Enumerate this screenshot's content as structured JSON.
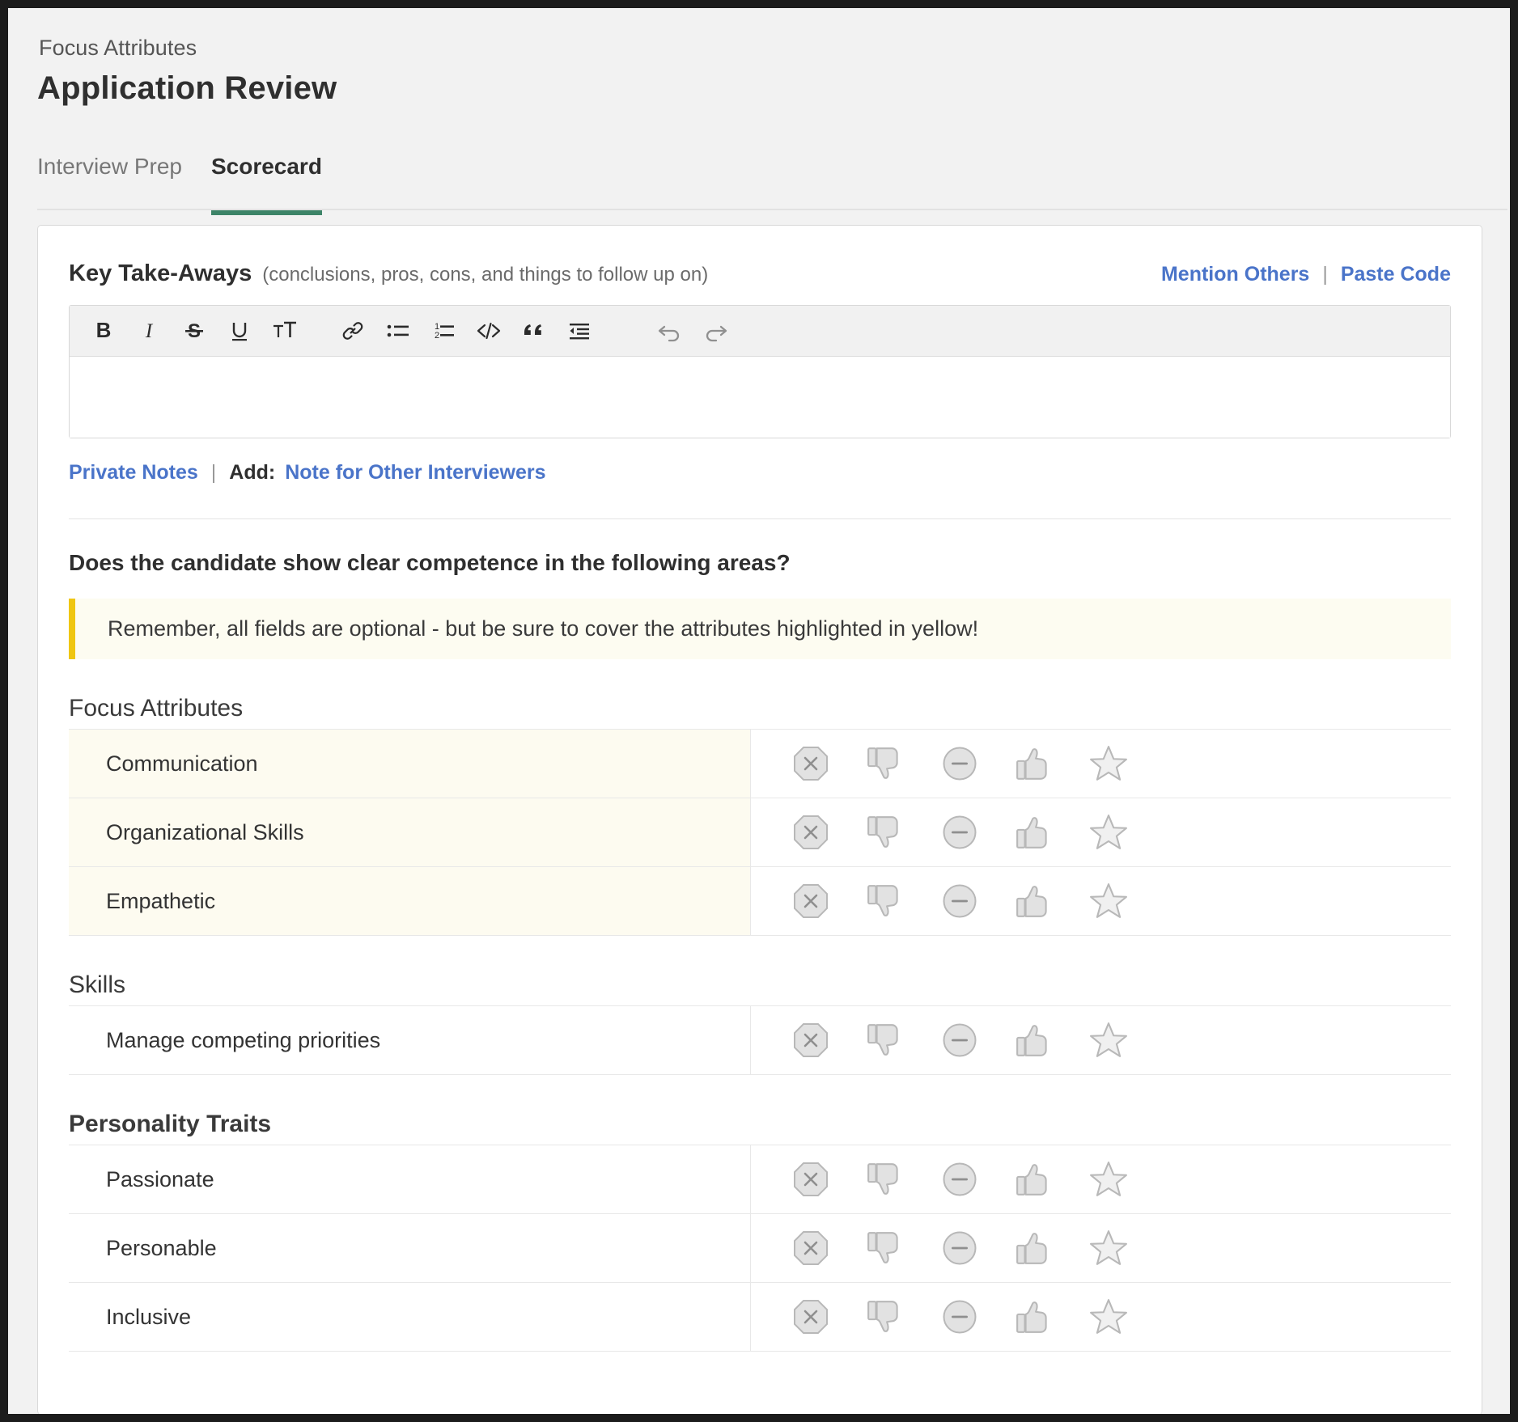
{
  "header": {
    "breadcrumb": "Focus Attributes",
    "title": "Application Review",
    "tabs": [
      {
        "label": "Interview Prep",
        "active": false
      },
      {
        "label": "Scorecard",
        "active": true
      }
    ],
    "active_tab_color": "#3d8468"
  },
  "key_takeaways": {
    "title": "Key Take-Aways",
    "subtitle": "(conclusions, pros, cons, and things to follow up on)",
    "mention_others": "Mention Others",
    "separator": "|",
    "paste_code": "Paste Code",
    "editor_value": "",
    "toolbar": [
      {
        "name": "bold-icon",
        "label": "B"
      },
      {
        "name": "italic-icon",
        "label": "I"
      },
      {
        "name": "strikethrough-icon",
        "label": "S"
      },
      {
        "name": "underline-icon",
        "label": "U"
      },
      {
        "name": "font-size-icon",
        "label": "TT"
      },
      {
        "name": "link-icon",
        "label": "link"
      },
      {
        "name": "bulleted-list-icon",
        "label": "bullets"
      },
      {
        "name": "numbered-list-icon",
        "label": "numbers"
      },
      {
        "name": "code-icon",
        "label": "</>"
      },
      {
        "name": "blockquote-icon",
        "label": "quote"
      },
      {
        "name": "indent-icon",
        "label": "indent"
      },
      {
        "name": "undo-icon",
        "label": "undo"
      },
      {
        "name": "redo-icon",
        "label": "redo"
      }
    ]
  },
  "notes": {
    "private_notes": "Private Notes",
    "separator": "|",
    "add_label": "Add:",
    "note_for_others": "Note for Other Interviewers",
    "link_color": "#4a74c9"
  },
  "question": "Does the candidate show clear competence in the following areas?",
  "callout": {
    "text": "Remember, all fields are optional - but be sure to cover the attributes highlighted in yellow!",
    "bar_color": "#efc612",
    "background": "#fdfcf1"
  },
  "rating_options": [
    {
      "name": "rating-strong-no-icon",
      "label": "Strong No"
    },
    {
      "name": "rating-thumbs-down-icon",
      "label": "No"
    },
    {
      "name": "rating-neutral-icon",
      "label": "Neutral"
    },
    {
      "name": "rating-thumbs-up-icon",
      "label": "Yes"
    },
    {
      "name": "rating-star-icon",
      "label": "Strong Yes"
    }
  ],
  "sections": [
    {
      "title": "Focus Attributes",
      "bold": false,
      "rows": [
        {
          "label": "Communication",
          "highlighted": true,
          "rating": null
        },
        {
          "label": "Organizational Skills",
          "highlighted": true,
          "rating": null
        },
        {
          "label": "Empathetic",
          "highlighted": true,
          "rating": null
        }
      ]
    },
    {
      "title": "Skills",
      "bold": false,
      "rows": [
        {
          "label": "Manage competing priorities",
          "highlighted": false,
          "rating": null
        }
      ]
    },
    {
      "title": "Personality Traits",
      "bold": true,
      "rows": [
        {
          "label": "Passionate",
          "highlighted": false,
          "rating": null
        },
        {
          "label": "Personable",
          "highlighted": false,
          "rating": null
        },
        {
          "label": "Inclusive",
          "highlighted": false,
          "rating": null
        }
      ]
    }
  ]
}
